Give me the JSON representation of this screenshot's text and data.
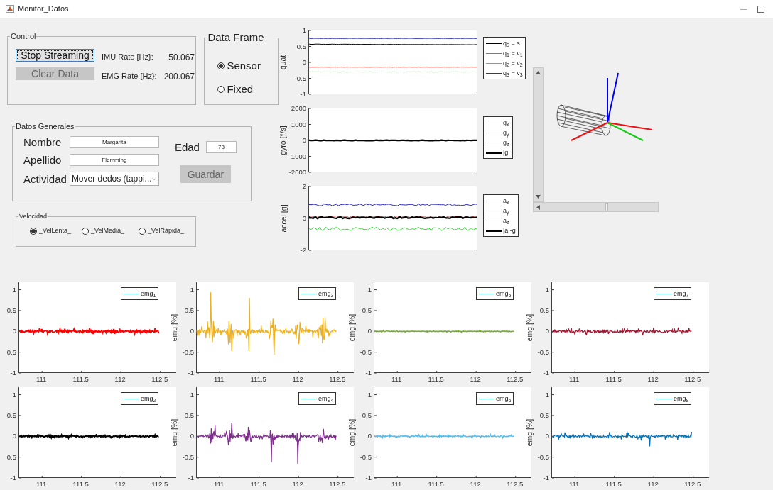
{
  "window": {
    "title": "Monitor_Datos"
  },
  "control": {
    "title": "Control",
    "buttons": [
      {
        "label": "Stop Streaming",
        "disabled": false,
        "focused": true
      },
      {
        "label": "Clear Data",
        "disabled": true,
        "focused": false
      }
    ],
    "rates": [
      {
        "label": "IMU Rate [Hz}:",
        "value": "50.067"
      },
      {
        "label": "EMG Rate [Hz}:",
        "value": "200.067"
      }
    ]
  },
  "data_frame": {
    "title": "Data Frame",
    "options": [
      {
        "label": "Sensor",
        "selected": true
      },
      {
        "label": "Fixed",
        "selected": false
      }
    ]
  },
  "datos_generales": {
    "title": "Datos Generales",
    "fields": [
      {
        "label": "Nombre",
        "value": "Margarita"
      },
      {
        "label": "Apellido",
        "value": "Flemming"
      }
    ],
    "actividad": {
      "label": "Actividad",
      "value": "Mover dedos (tappi..."
    },
    "edad": {
      "label": "Edad",
      "value": "73"
    },
    "save_button": {
      "label": "Guardar",
      "disabled": true
    }
  },
  "velocidad": {
    "title": "Velocidad",
    "options": [
      {
        "label": "_VelLenta_",
        "selected": true
      },
      {
        "label": "_VelMedia_",
        "selected": false
      },
      {
        "label": "_VelRápida_",
        "selected": false
      }
    ]
  },
  "imu_plots": [
    {
      "ylabel": "quat",
      "yticks": [
        "1",
        "0.5",
        "0",
        "-0.5",
        "-1"
      ],
      "series": [
        {
          "label": "q$_{0}$ = s",
          "color": "#000000",
          "kind": "component"
        },
        {
          "label": "q$_{1}$ = v$_{1}$",
          "color": "#d95353",
          "kind": "component"
        },
        {
          "label": "q$_{2}$ = v$_{2}$",
          "color": "#33d633",
          "kind": "component"
        },
        {
          "label": "q$_{3}$ = v$_{3}$",
          "color": "#2b2bc0",
          "kind": "component"
        }
      ]
    },
    {
      "ylabel": "gyro [°/s]",
      "yticks": [
        "2000",
        "1000",
        "0",
        "-1000",
        "-2000"
      ],
      "series": [
        {
          "label": "g$_{x}$",
          "color": "#e07070",
          "kind": "component"
        },
        {
          "label": "g$_{y}$",
          "color": "#33d633",
          "kind": "component"
        },
        {
          "label": "g$_{z}$",
          "color": "#2b2bc0",
          "kind": "component"
        },
        {
          "label": "|g|",
          "color": "#000000",
          "kind": "magnitude"
        }
      ]
    },
    {
      "ylabel": "accel [g]",
      "yticks": [
        "2",
        "0",
        "-2"
      ],
      "series": [
        {
          "label": "a$_{x}$",
          "color": "#d95353",
          "kind": "component"
        },
        {
          "label": "a$_{y}$",
          "color": "#33d633",
          "kind": "component"
        },
        {
          "label": "a$_{z}$",
          "color": "#2b2bc0",
          "kind": "component"
        },
        {
          "label": "|a|-g",
          "color": "#000000",
          "kind": "magnitude"
        }
      ]
    }
  ],
  "emg_plots": [
    {
      "legend": "emg$_{1}$",
      "color": "#ff0000",
      "yticks": [
        "1",
        "0.5",
        "0",
        "0.5",
        "-1"
      ],
      "xticks": [
        "111",
        "111.5",
        "112",
        "112.5"
      ]
    },
    {
      "legend": "emg$_{3}$",
      "color": "#edb120",
      "ylabel": "emg [%]",
      "yticks": [
        "1",
        "0.5",
        "0",
        "-0.5",
        "-1"
      ],
      "xticks": [
        "111",
        "111.5",
        "112",
        "112.5"
      ]
    },
    {
      "legend": "emg$_{5}$",
      "color": "#77ac30",
      "ylabel": "emg [%]",
      "yticks": [
        "1",
        "0.5",
        "0",
        "-0.5",
        "-1"
      ],
      "xticks": [
        "111",
        "111.5",
        "112",
        "112.5"
      ]
    },
    {
      "legend": "emg$_{7}$",
      "color": "#a2142f",
      "ylabel": "emg [%]",
      "yticks": [
        "1",
        "0.5",
        "0",
        "-0.5",
        "-1"
      ],
      "xticks": [
        "111",
        "111.5",
        "112",
        "112.5"
      ]
    },
    {
      "legend": "emg$_{2}$",
      "color": "#000000",
      "yticks": [
        "1",
        "0.5",
        "0",
        "0.5",
        "-1"
      ],
      "xticks": [
        "111",
        "111.5",
        "112",
        "112.5"
      ]
    },
    {
      "legend": "emg$_{4}$",
      "color": "#7e2f8e",
      "ylabel": "emg [%]",
      "yticks": [
        "1",
        "0.5",
        "0",
        "-0.5",
        "-1"
      ],
      "xticks": [
        "111",
        "111.5",
        "112",
        "112.5"
      ]
    },
    {
      "legend": "emg$_{6}$",
      "color": "#4dbeee",
      "ylabel": "emg [%]",
      "yticks": [
        "1",
        "0.5",
        "0",
        "-0.5",
        "-1"
      ],
      "xticks": [
        "111",
        "111.5",
        "112",
        "112.5"
      ]
    },
    {
      "legend": "emg$_{8}$",
      "color": "#0072bd",
      "ylabel": "emg [%]",
      "yticks": [
        "1",
        "0.5",
        "0",
        "-0.5",
        "-1"
      ],
      "xticks": [
        "111",
        "111.5",
        "112",
        "112.5"
      ]
    }
  ]
}
